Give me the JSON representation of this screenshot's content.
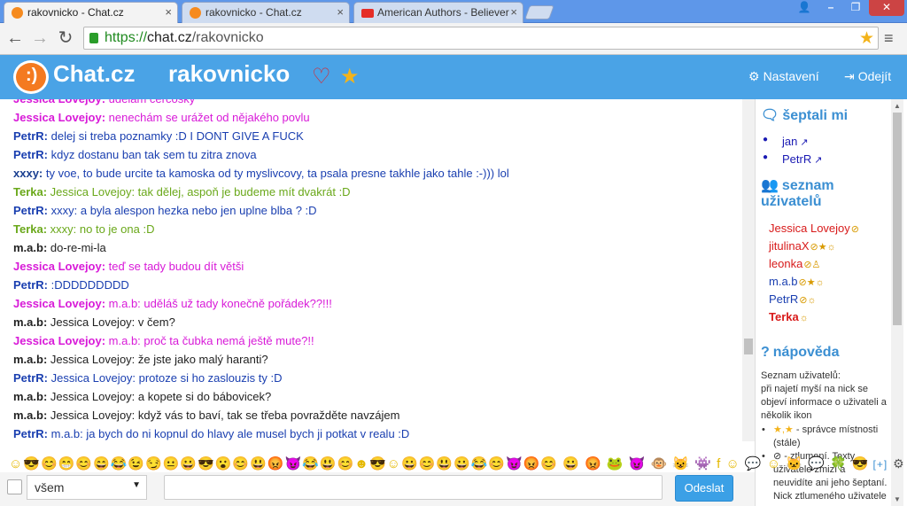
{
  "browser": {
    "tabs": [
      {
        "title": "rakovnicko - Chat.cz",
        "close": "×"
      },
      {
        "title": "rakovnicko - Chat.cz",
        "close": "×"
      },
      {
        "title": "American Authors - Believer",
        "close": "×"
      }
    ],
    "url_scheme": "https://",
    "url_host": "chat.cz",
    "url_path": "/rakovnicko"
  },
  "header": {
    "brand": "Chat.cz",
    "room": "rakovnicko",
    "settings_label": "Nastavení",
    "logout_label": "Odejít"
  },
  "messages": [
    {
      "nick": "Jessica Lovejoy:",
      "text": " udělám čerčosky",
      "color": "#d81ad8"
    },
    {
      "nick": "Jessica Lovejoy:",
      "text": " nenechám se urážet od nějakého povlu",
      "color": "#d81ad8"
    },
    {
      "nick": "PetrR:",
      "text": " delej si treba poznamky :D I DONT GIVE A FUCK",
      "color": "#1a3fb0"
    },
    {
      "nick": "PetrR:",
      "text": " kdyz dostanu ban tak sem tu zitra znova",
      "color": "#1a3fb0"
    },
    {
      "nick": "xxxy:",
      "text": " ty voe, to bude urcite ta kamoska od ty myslivcovy, ta psala presne takhle jako tahle :-))) lol",
      "color": "#1a3fb0",
      "nick_color": "#1a3f90"
    },
    {
      "nick": "Terka:",
      "text": " Jessica Lovejoy: tak dělej, aspoň je budeme mít dvakrát :D",
      "color": "#6aa81a"
    },
    {
      "nick": "PetrR:",
      "text": " xxxy: a byla alespon hezka nebo jen uplne blba ? :D",
      "color": "#1a3fb0"
    },
    {
      "nick": "Terka:",
      "text": " xxxy: no to je ona :D",
      "color": "#6aa81a"
    },
    {
      "nick": "m.a.b:",
      "text": " do-re-mi-la",
      "color": "#222222"
    },
    {
      "nick": "Jessica Lovejoy:",
      "text": " teď se tady budou dít větši",
      "color": "#d81ad8"
    },
    {
      "nick": "PetrR:",
      "text": " :DDDDDDDDD",
      "color": "#1a3fb0"
    },
    {
      "nick": "Jessica Lovejoy:",
      "text": " m.a.b: uděláš už tady konečně pořádek??!!!",
      "color": "#d81ad8"
    },
    {
      "nick": "m.a.b:",
      "text": " Jessica Lovejoy: v čem?",
      "color": "#222222"
    },
    {
      "nick": "Jessica Lovejoy:",
      "text": " m.a.b: proč ta čubka nemá ještě mute?!!",
      "color": "#d81ad8"
    },
    {
      "nick": "m.a.b:",
      "text": " Jessica Lovejoy: že jste jako malý haranti?",
      "color": "#222222"
    },
    {
      "nick": "PetrR:",
      "text": " Jessica Lovejoy: protoze si ho zaslouzis ty :D",
      "color": "#1a3fb0"
    },
    {
      "nick": "m.a.b:",
      "text": " Jessica Lovejoy: a kopete si do bábovicek?",
      "color": "#222222"
    },
    {
      "nick": "m.a.b:",
      "text": " Jessica Lovejoy: když vás to baví, tak se třeba povražděte navzájem",
      "color": "#222222"
    },
    {
      "nick": "PetrR:",
      "text": " m.a.b: ja bych do ni kopnul do hlavy ale musel bych ji potkat v realu :D",
      "color": "#1a3fb0"
    }
  ],
  "sidebar": {
    "whispered_title": "šeptali mi",
    "whispered": [
      "jan",
      "PetrR"
    ],
    "users_title": "seznam uživatelů",
    "users": [
      {
        "name": "Jessica Lovejoy",
        "color": "#d81a1a",
        "icons": "⊘"
      },
      {
        "name": "jitulinaX",
        "color": "#d81a1a",
        "icons": "⊘★☼"
      },
      {
        "name": "leonka",
        "color": "#d81a1a",
        "icons": "⊘♙"
      },
      {
        "name": "m.a.b",
        "color": "#1a3fb0",
        "icons": "⊘★☼"
      },
      {
        "name": "PetrR",
        "color": "#1a3fb0",
        "icons": "⊘☼"
      },
      {
        "name": "Terka",
        "color": "#d81a1a",
        "icons": "☼",
        "bold": true
      }
    ],
    "help_title": "nápověda",
    "help_text": [
      "Seznam uživatelů:",
      "při najetí myší na nick se",
      "objeví informace o uživateli a",
      "několik ikon"
    ],
    "help_bullets": [
      {
        "icon": "★,★",
        "lines": [
          "- správce místnosti",
          "(stále)"
        ]
      },
      {
        "icon": "⊘",
        "lines": [
          "- ztlumení. Texty",
          "uživatele zmizí a",
          "neuvidíte ani jeho šeptaní.",
          "Nick ztlumeného uživatele"
        ]
      }
    ]
  },
  "smileys": "☺😎😊😁😊😄😂😉😏😐😀😎😮😊😃😡😈😂😃😊☻😎☺😀😊😃😀😂😊😈😡😊 😀 😡 🐸 😈 🐵 😺 👾 f ☺ 💬 ☺ 🐱 💬 🍀 😎",
  "smileys_more": "[+]",
  "input": {
    "target": "všem",
    "send_label": "Odeslat"
  }
}
